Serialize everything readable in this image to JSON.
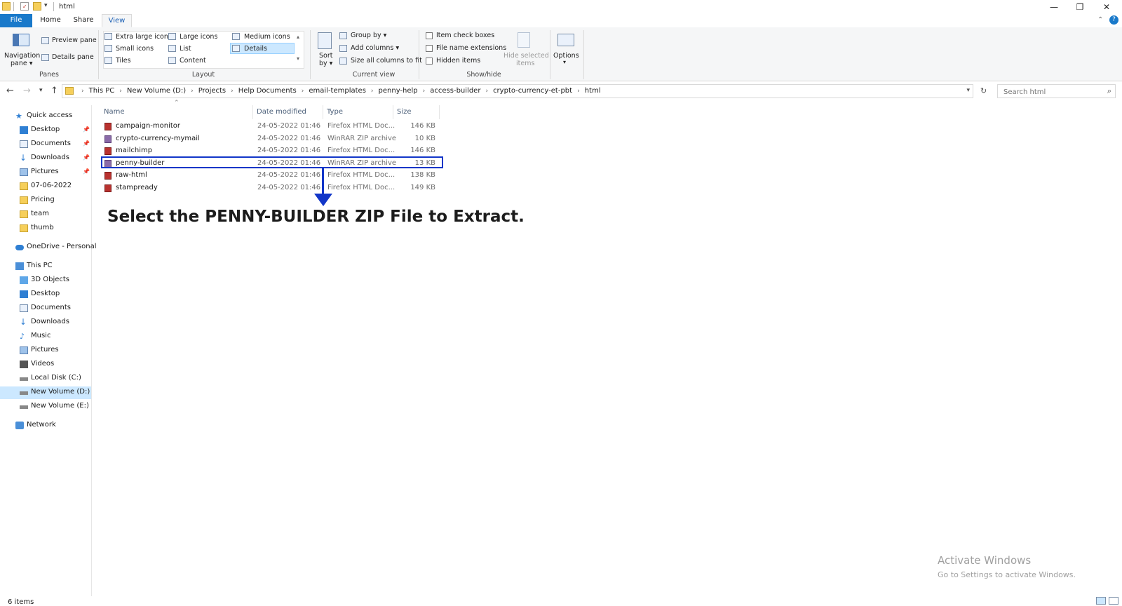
{
  "window": {
    "title": "html",
    "minimize_glyph": "—",
    "restore_glyph": "❐",
    "close_glyph": "✕"
  },
  "ribbon_tabs": [
    {
      "label": "File"
    },
    {
      "label": "Home"
    },
    {
      "label": "Share"
    },
    {
      "label": "View"
    }
  ],
  "ribbon": {
    "panes": {
      "navigation_pane": "Navigation",
      "navigation_pane2": "pane ▾",
      "preview_pane": "Preview pane",
      "details_pane": "Details pane",
      "group_label": "Panes"
    },
    "layout": {
      "items": [
        "Extra large icons",
        "Large icons",
        "Medium icons",
        "Small icons",
        "List",
        "Details",
        "Tiles",
        "Content"
      ],
      "selected": "Details",
      "group_label": "Layout"
    },
    "current_view": {
      "sort_by": "Sort",
      "sort_by2": "by ▾",
      "group_by": "Group by ▾",
      "add_columns": "Add columns ▾",
      "size_all_columns": "Size all columns to fit",
      "group_label": "Current view"
    },
    "show_hide": {
      "item_check_boxes": "Item check boxes",
      "file_name_extensions": "File name extensions",
      "hidden_items": "Hidden items",
      "hide_selected": "Hide selected",
      "hide_selected2": "items",
      "group_label": "Show/hide"
    },
    "options": "Options",
    "options2": "▾"
  },
  "address": {
    "crumbs": [
      "This PC",
      "New Volume (D:)",
      "Projects",
      "Help Documents",
      "email-templates",
      "penny-help",
      "access-builder",
      "crypto-currency-et-pbt",
      "html"
    ]
  },
  "search": {
    "placeholder": "Search html"
  },
  "nav_pane": [
    {
      "label": "Quick access",
      "pinned": false
    },
    {
      "label": "Desktop",
      "pinned": true
    },
    {
      "label": "Documents",
      "pinned": true
    },
    {
      "label": "Downloads",
      "pinned": true
    },
    {
      "label": "Pictures",
      "pinned": true
    },
    {
      "label": "07-06-2022",
      "pinned": false
    },
    {
      "label": "Pricing",
      "pinned": false
    },
    {
      "label": "team",
      "pinned": false
    },
    {
      "label": "thumb",
      "pinned": false
    },
    {
      "label": "OneDrive - Personal",
      "pinned": false
    },
    {
      "label": "This PC",
      "pinned": false
    },
    {
      "label": "3D Objects",
      "pinned": false
    },
    {
      "label": "Desktop",
      "pinned": false
    },
    {
      "label": "Documents",
      "pinned": false
    },
    {
      "label": "Downloads",
      "pinned": false
    },
    {
      "label": "Music",
      "pinned": false
    },
    {
      "label": "Pictures",
      "pinned": false
    },
    {
      "label": "Videos",
      "pinned": false
    },
    {
      "label": "Local Disk (C:)",
      "pinned": false
    },
    {
      "label": "New Volume (D:)",
      "pinned": false
    },
    {
      "label": "New Volume (E:)",
      "pinned": false
    },
    {
      "label": "Network",
      "pinned": false
    }
  ],
  "columns": {
    "name": "Name",
    "date": "Date modified",
    "type": "Type",
    "size": "Size"
  },
  "files": [
    {
      "name": "campaign-monitor",
      "date": "24-05-2022 01:46",
      "type": "Firefox HTML Doc...",
      "size": "146 KB",
      "kind": "html"
    },
    {
      "name": "crypto-currency-mymail",
      "date": "24-05-2022 01:46",
      "type": "WinRAR ZIP archive",
      "size": "10 KB",
      "kind": "zip"
    },
    {
      "name": "mailchimp",
      "date": "24-05-2022 01:46",
      "type": "Firefox HTML Doc...",
      "size": "146 KB",
      "kind": "html"
    },
    {
      "name": "penny-builder",
      "date": "24-05-2022 01:46",
      "type": "WinRAR ZIP archive",
      "size": "13 KB",
      "kind": "zip"
    },
    {
      "name": "raw-html",
      "date": "24-05-2022 01:46",
      "type": "Firefox HTML Doc...",
      "size": "138 KB",
      "kind": "html"
    },
    {
      "name": "stampready",
      "date": "24-05-2022 01:46",
      "type": "Firefox HTML Doc...",
      "size": "149 KB",
      "kind": "html"
    }
  ],
  "annotation": {
    "instruction": "Select the PENNY-BUILDER ZIP File to Extract."
  },
  "watermark": {
    "title": "Activate Windows",
    "subtitle": "Go to Settings to activate Windows."
  },
  "status": {
    "count": "6 items"
  },
  "colors": {
    "accent": "#1979ca",
    "highlight": "#1236c8",
    "selected_nav": "#cce8ff"
  }
}
